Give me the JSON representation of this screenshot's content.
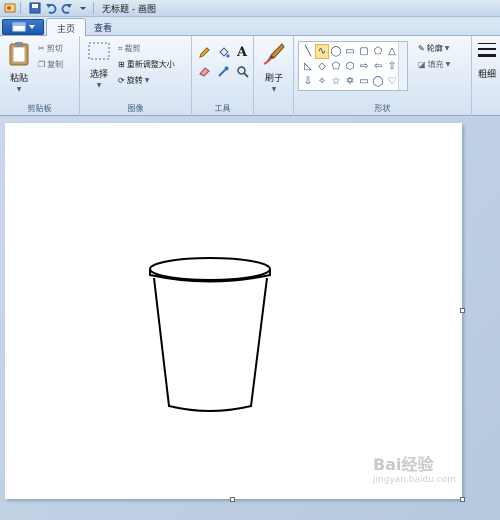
{
  "titlebar": {
    "title": "无标题 - 画图"
  },
  "tabs": {
    "home": "主页",
    "view": "查看"
  },
  "clipboard": {
    "paste": "粘贴",
    "cut": "剪切",
    "copy": "复制",
    "group": "剪贴板"
  },
  "image": {
    "select": "选择",
    "crop": "裁剪",
    "resize": "重新调整大小",
    "rotate": "旋转",
    "group": "图像"
  },
  "tools": {
    "text_tool": "A",
    "group": "工具"
  },
  "brushes": {
    "label": "刷子"
  },
  "shapes": {
    "group": "形状",
    "outline": "轮廓",
    "fill": "填充"
  },
  "size": {
    "label": "粗细"
  },
  "watermark": {
    "brand": "Bai",
    "brand2": "经验",
    "url": "jingyan.baidu.com"
  }
}
